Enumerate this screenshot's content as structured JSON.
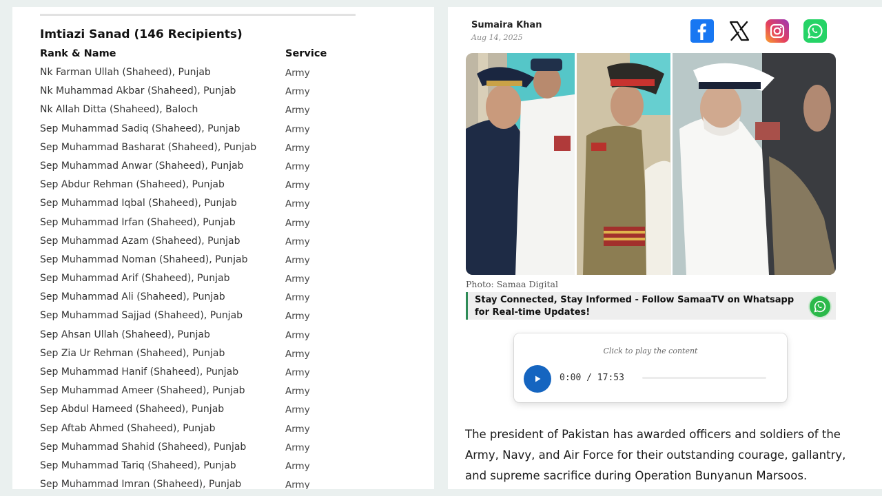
{
  "left": {
    "section_title": "Imtiazi Sanad (146 Recipients)",
    "columns": {
      "name": "Rank & Name",
      "service": "Service"
    },
    "rows": [
      {
        "name": "Nk Farman Ullah (Shaheed), Punjab",
        "service": "Army"
      },
      {
        "name": "Nk Muhammad Akbar (Shaheed), Punjab",
        "service": "Army"
      },
      {
        "name": "Nk Allah Ditta (Shaheed), Baloch",
        "service": "Army"
      },
      {
        "name": "Sep Muhammad Sadiq (Shaheed), Punjab",
        "service": "Army"
      },
      {
        "name": "Sep Muhammad Basharat (Shaheed), Punjab",
        "service": "Army"
      },
      {
        "name": "Sep Muhammad Anwar (Shaheed), Punjab",
        "service": "Army"
      },
      {
        "name": "Sep Abdur Rehman (Shaheed), Punjab",
        "service": "Army"
      },
      {
        "name": "Sep Muhammad Iqbal (Shaheed), Punjab",
        "service": "Army"
      },
      {
        "name": "Sep Muhammad Irfan (Shaheed), Punjab",
        "service": "Army"
      },
      {
        "name": "Sep Muhammad Azam (Shaheed), Punjab",
        "service": "Army"
      },
      {
        "name": "Sep Muhammad Noman (Shaheed), Punjab",
        "service": "Army"
      },
      {
        "name": "Sep Muhammad Arif (Shaheed), Punjab",
        "service": "Army"
      },
      {
        "name": "Sep Muhammad Ali (Shaheed), Punjab",
        "service": "Army"
      },
      {
        "name": "Sep Muhammad Sajjad (Shaheed), Punjab",
        "service": "Army"
      },
      {
        "name": "Sep Ahsan Ullah (Shaheed), Punjab",
        "service": "Army"
      },
      {
        "name": "Sep Zia Ur Rehman (Shaheed), Punjab",
        "service": "Army"
      },
      {
        "name": "Sep Muhammad Hanif (Shaheed), Punjab",
        "service": "Army"
      },
      {
        "name": "Sep Muhammad Ameer (Shaheed), Punjab",
        "service": "Army"
      },
      {
        "name": "Sep Abdul Hameed (Shaheed), Punjab",
        "service": "Army"
      },
      {
        "name": "Sep Aftab Ahmed (Shaheed), Punjab",
        "service": "Army"
      },
      {
        "name": "Sep Muhammad Shahid (Shaheed), Punjab",
        "service": "Army"
      },
      {
        "name": "Sep Muhammad Tariq (Shaheed), Punjab",
        "service": "Army"
      },
      {
        "name": "Sep Muhammad Imran (Shaheed), Punjab",
        "service": "Army"
      }
    ]
  },
  "right": {
    "author": "Sumaira Khan",
    "date": "Aug 14, 2025",
    "share_icons": [
      "facebook-icon",
      "x-icon",
      "instagram-icon",
      "whatsapp-icon"
    ],
    "photo_caption": "Photo: Samaa Digital",
    "follow_text": "Stay Connected, Stay Informed - Follow SamaaTV on Whatsapp for Real-time Updates!",
    "audio": {
      "hint": "Click to play the content",
      "current_time": "0:00",
      "separator": "/",
      "duration": "17:53",
      "progress": 0
    },
    "article_text": "The president of Pakistan has awarded officers and soldiers of the Army, Navy, and Air Force for their outstanding courage, gallantry, and supreme sacrifice during Operation Bunyanun Marsoos."
  },
  "colors": {
    "page_bg": "#eaf0ef",
    "accent_blue": "#1565c0",
    "facebook": "#1877f2",
    "whatsapp": "#25d366",
    "follow_border": "#2e8b57"
  }
}
